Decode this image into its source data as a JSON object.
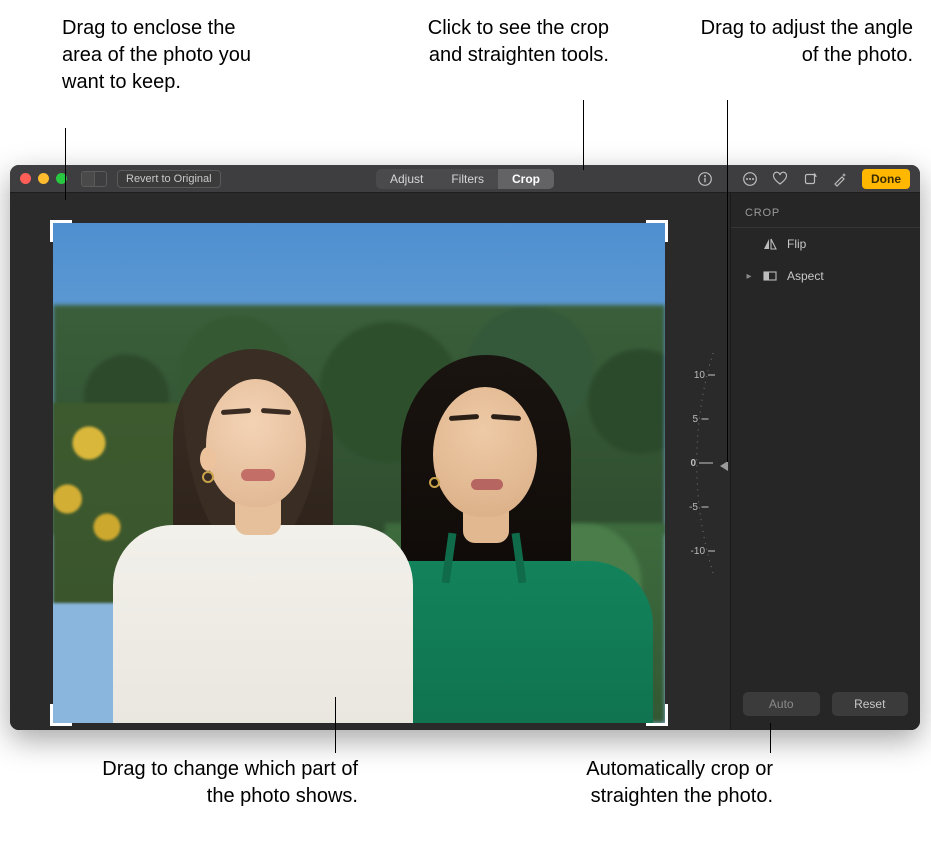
{
  "callouts": {
    "tl": "Drag to enclose the area of the photo you want to keep.",
    "tc": "Click to see the crop and straighten tools.",
    "tr": "Drag to adjust the angle of the photo.",
    "bl": "Drag to change which part of the photo shows.",
    "bc": "Automatically crop or straighten the photo."
  },
  "toolbar": {
    "revert_label": "Revert to Original",
    "tabs": {
      "adjust": "Adjust",
      "filters": "Filters",
      "crop": "Crop"
    },
    "done_label": "Done"
  },
  "sidebar": {
    "header": "CROP",
    "flip_label": "Flip",
    "aspect_label": "Aspect"
  },
  "angle": {
    "labels": [
      "10",
      "5",
      "0",
      "-5",
      "-10"
    ],
    "current": "0"
  },
  "footer": {
    "auto": "Auto",
    "reset": "Reset"
  }
}
